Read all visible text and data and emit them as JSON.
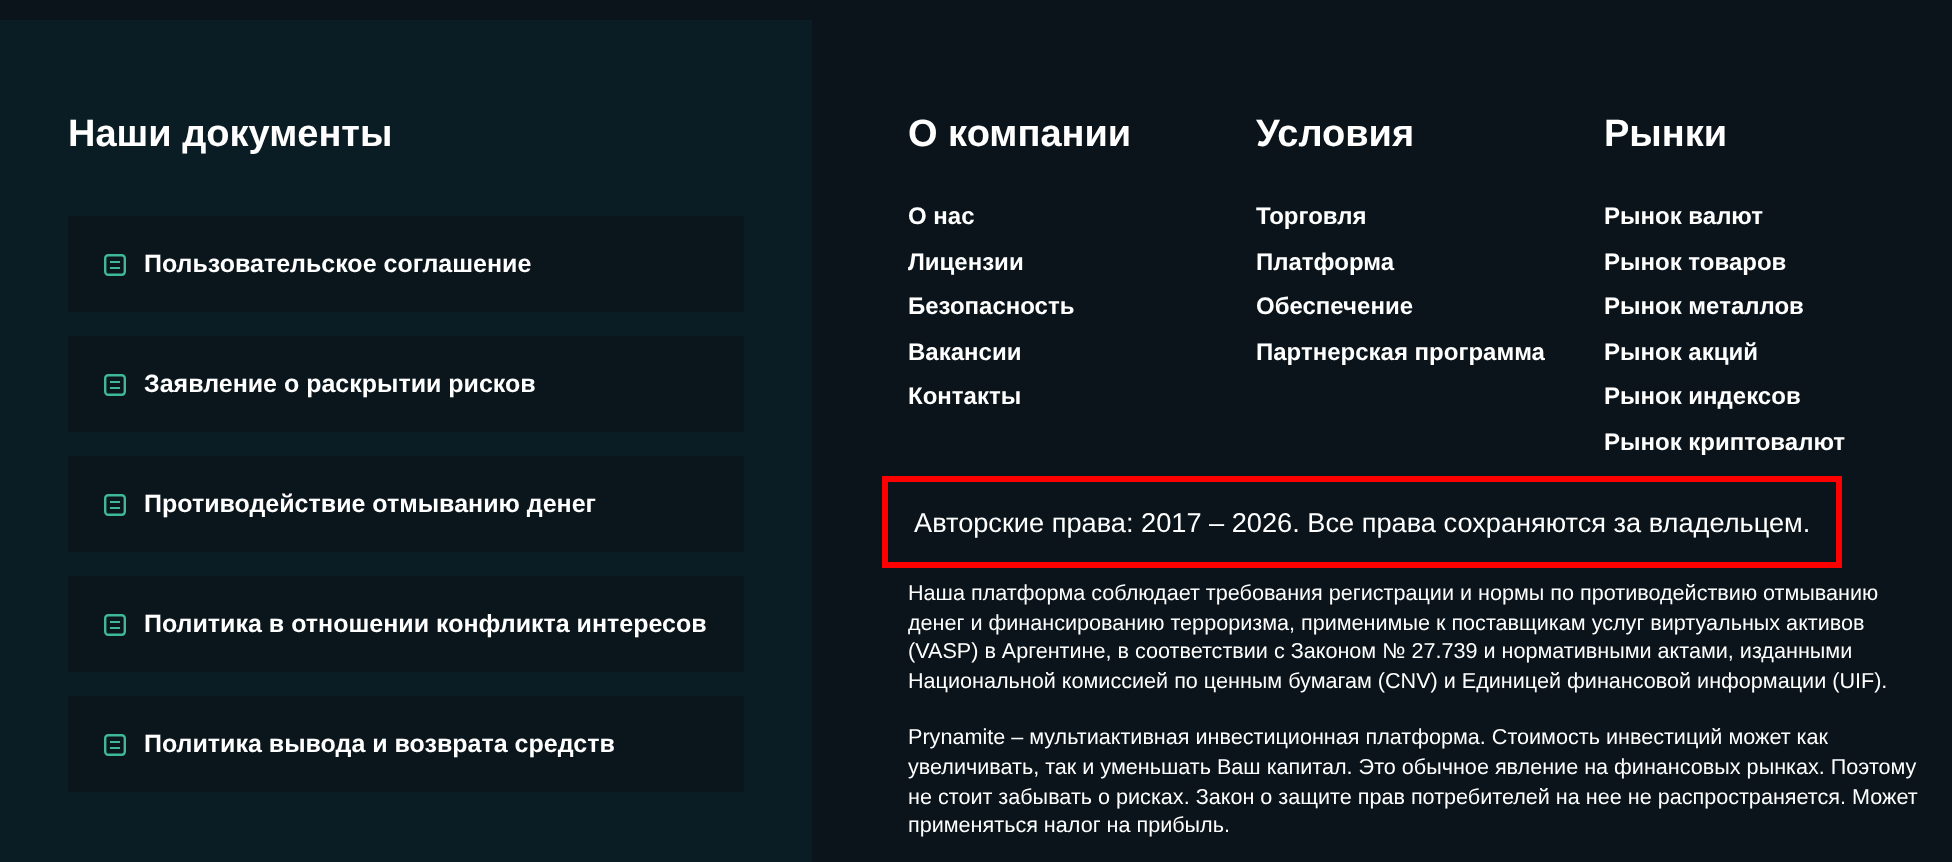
{
  "documents": {
    "title": "Наши документы",
    "items": [
      {
        "label": "Пользовательское соглашение"
      },
      {
        "label": "Заявление о раскрытии рисков"
      },
      {
        "label": "Противодействие отмыванию денег"
      },
      {
        "label": "Политика в отношении конфликта интересов"
      },
      {
        "label": "Политика вывода и возврата средств"
      }
    ]
  },
  "columns": [
    {
      "title": "О компании",
      "links": [
        "О нас",
        "Лицензии",
        "Безопасность",
        "Вакансии",
        "Контакты"
      ]
    },
    {
      "title": "Условия",
      "links": [
        "Торговля",
        "Платформа",
        "Обеспечение",
        "Партнерская программа"
      ]
    },
    {
      "title": "Рынки",
      "links": [
        "Рынок валют",
        "Рынок товаров",
        "Рынок металлов",
        "Рынок акций",
        "Рынок индексов",
        "Рынок криптовалют"
      ]
    }
  ],
  "copyright": {
    "text": "Авторские права: 2017 – 2026. Все права сохраняются за владельцем.",
    "highlighted": true
  },
  "disclaimers": [
    "Наша платформа соблюдает требования регистрации и нормы по противодействию отмыванию денег и финансированию терроризма, применимые к поставщикам услуг виртуальных активов (VASP) в Аргентине, в соответствии с Законом № 27.739 и нормативными актами, изданными Национальной комиссией по ценным бумагам (CNV) и Единицей финансовой информации (UIF).",
    "Prynamite – мультиактивная инвестиционная платформа. Стоимость инвестиций может как увеличивать, так и уменьшать Ваш капитал. Это обычное явление на финансовых рынках. Поэтому не стоит забывать о рисках. Закон о защите прав потребителей на нее не распространяется. Может применяться налог на прибыль."
  ]
}
